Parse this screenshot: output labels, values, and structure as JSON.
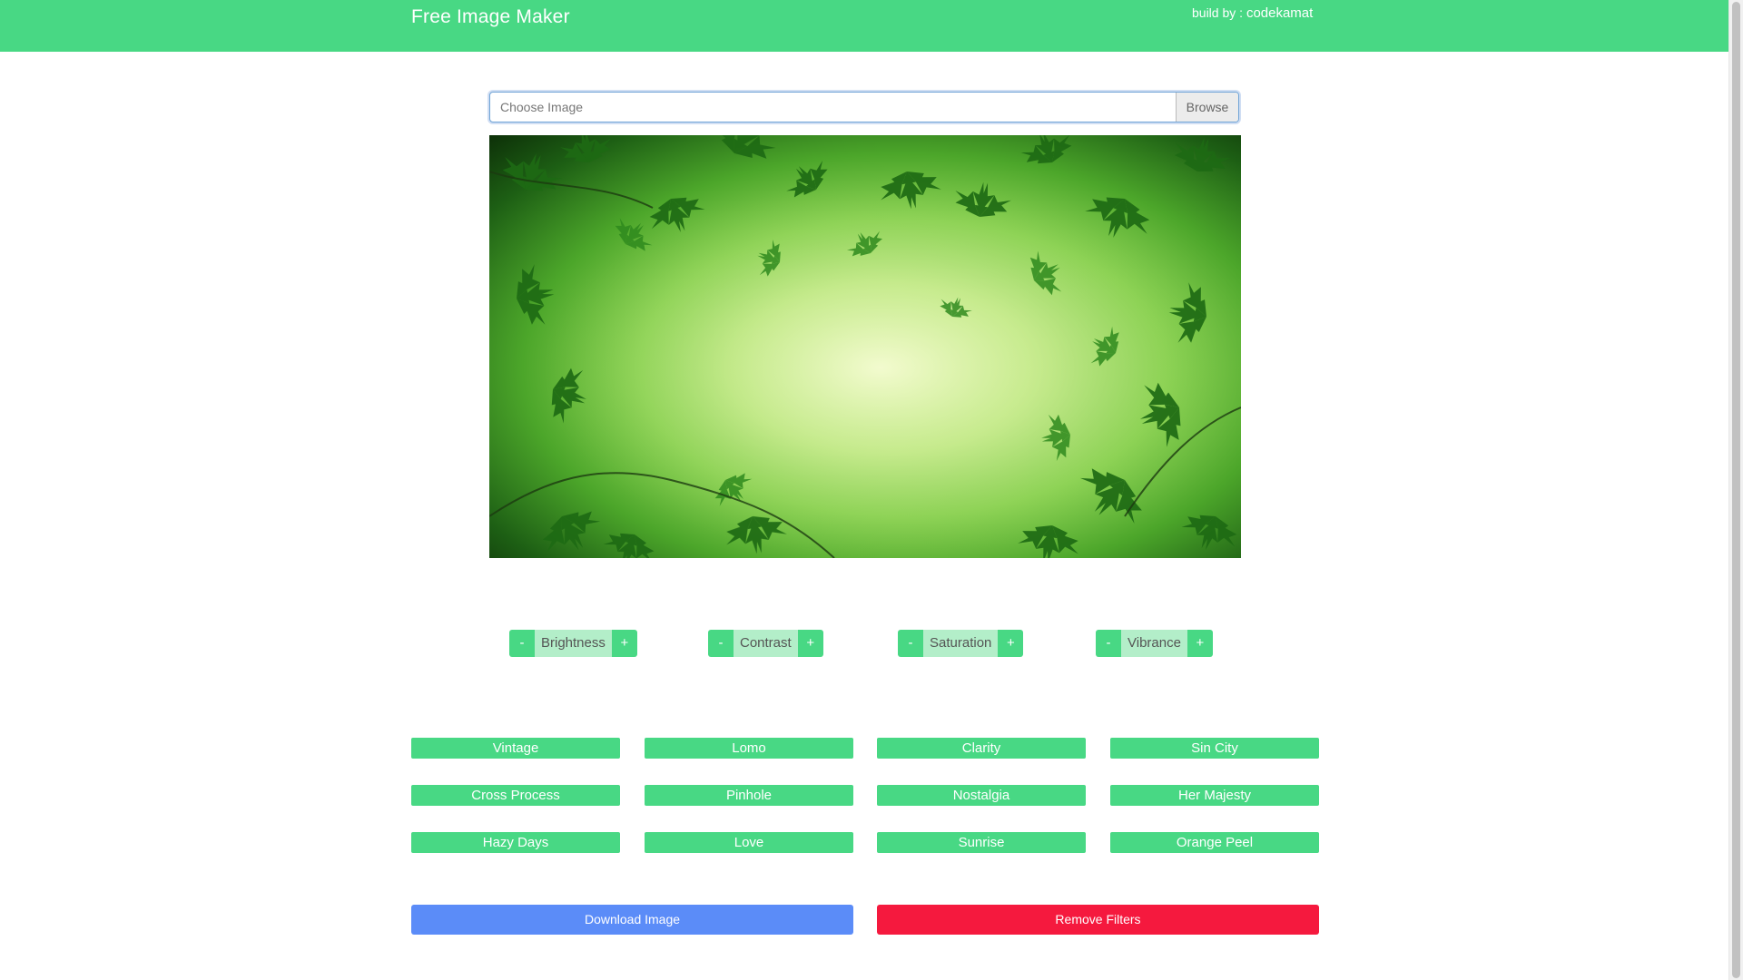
{
  "navbar": {
    "brand": "Free Image Maker",
    "credit_prefix": "build by : ",
    "credit_author": "codekamat"
  },
  "file_input": {
    "placeholder": "Choose Image",
    "browse_label": "Browse"
  },
  "preview": {
    "description_name": "green-maple-leaves-image"
  },
  "adjustments": [
    {
      "minus": "-",
      "label": "Brightness",
      "plus": "+"
    },
    {
      "minus": "-",
      "label": "Contrast",
      "plus": "+"
    },
    {
      "minus": "-",
      "label": "Saturation",
      "plus": "+"
    },
    {
      "minus": "-",
      "label": "Vibrance",
      "plus": "+"
    }
  ],
  "filters": [
    [
      "Vintage",
      "Lomo",
      "Clarity",
      "Sin City"
    ],
    [
      "Cross Process",
      "Pinhole",
      "Nostalgia",
      "Her Majesty"
    ],
    [
      "Hazy Days",
      "Love",
      "Sunrise",
      "Orange Peel"
    ]
  ],
  "actions": {
    "download_label": "Download Image",
    "remove_label": "Remove Filters"
  },
  "colors": {
    "accent": "#48d884",
    "download": "#5b8cf8",
    "remove": "#f5193e"
  }
}
